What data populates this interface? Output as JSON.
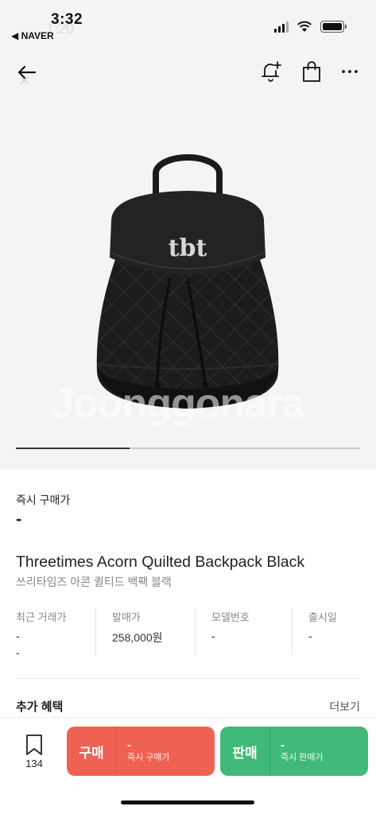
{
  "status_bar": {
    "time": "3:32",
    "time_ghost": "1:20",
    "back_app": "◀ NAVER",
    "icons": [
      "cellular-signal-icon",
      "wifi-icon",
      "battery-icon"
    ]
  },
  "nav": {
    "icons": [
      "back-arrow-icon",
      "alert-add-bell-icon",
      "shopping-bag-icon",
      "more-icon"
    ]
  },
  "product_image": {
    "subject": "black quilted drawstring backpack",
    "logo_text": "tbt",
    "watermark": "Joonggonara",
    "gallery_progress": 0.33
  },
  "details": {
    "buy_now_label": "즉시 구매가",
    "buy_now_price": "-",
    "name": "Threetimes Acorn Quilted Backpack Black",
    "subname": "쓰리타임즈 아콘 퀼티드 백팩 블랙"
  },
  "info": [
    {
      "label": "최근 거래가",
      "value": "-",
      "value2": "-"
    },
    {
      "label": "발매가",
      "value": "258,000원",
      "value2": ""
    },
    {
      "label": "모델번호",
      "value": "-",
      "value2": ""
    },
    {
      "label": "출시일",
      "value": "-",
      "value2": ""
    }
  ],
  "benefits": {
    "title": "추가 혜택",
    "more": "더보기"
  },
  "bottom_bar": {
    "wish_count": "134",
    "buy": {
      "label": "구매",
      "price": "-",
      "sub": "즉시 구매가"
    },
    "sell": {
      "label": "판매",
      "price": "-",
      "sub": "즉시 판매가"
    }
  },
  "colors": {
    "buy": "#ef6253",
    "sell": "#41b979",
    "image_bg": "#f4f4f4"
  }
}
